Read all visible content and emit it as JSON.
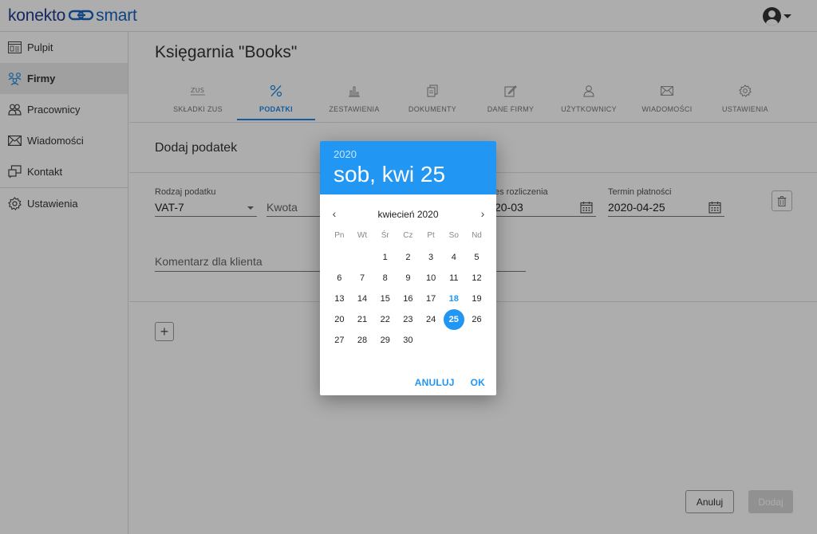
{
  "header": {
    "logo_part1": "konekto",
    "logo_part2": "smart",
    "account_icon": "account-circle-icon"
  },
  "sidebar": {
    "items": [
      {
        "label": "Pulpit",
        "icon": "dashboard-icon"
      },
      {
        "label": "Firmy",
        "icon": "companies-icon",
        "active": true
      },
      {
        "label": "Pracownicy",
        "icon": "employees-icon"
      },
      {
        "label": "Wiadomości",
        "icon": "mail-icon"
      },
      {
        "label": "Kontakt",
        "icon": "contact-icon"
      },
      {
        "label": "Ustawienia",
        "icon": "settings-icon"
      }
    ]
  },
  "main": {
    "page_title": "Księgarnia \"Books\"",
    "tabs": [
      {
        "label": "SKŁADKI ZUS",
        "icon": "zus-icon"
      },
      {
        "label": "PODATKI",
        "icon": "percent-icon",
        "active": true
      },
      {
        "label": "ZESTAWIENIA",
        "icon": "bar-chart-icon"
      },
      {
        "label": "DOKUMENTY",
        "icon": "documents-icon"
      },
      {
        "label": "DANE FIRMY",
        "icon": "edit-icon"
      },
      {
        "label": "UŻYTKOWNICY",
        "icon": "user-icon"
      },
      {
        "label": "WIADOMOŚCI",
        "icon": "mail-icon"
      },
      {
        "label": "USTAWIENIA",
        "icon": "gear-icon"
      }
    ],
    "section_title": "Dodaj podatek",
    "form": {
      "tax_type_label": "Rodzaj podatku",
      "tax_type_value": "VAT-7",
      "amount_placeholder": "Kwota",
      "period_label": "es rozliczenia",
      "period_value": "20-03",
      "due_label": "Termin płatności",
      "due_value": "2020-04-25",
      "comment_placeholder": "Komentarz dla klienta"
    },
    "cancel_label": "Anuluj",
    "add_label": "Dodaj"
  },
  "datepicker": {
    "year": "2020",
    "selected_display": "sob, kwi 25",
    "month_label": "kwiecień 2020",
    "weekdays": [
      "Pn",
      "Wt",
      "Śr",
      "Cz",
      "Pt",
      "So",
      "Nd"
    ],
    "weeks": [
      [
        "",
        "",
        "1",
        "2",
        "3",
        "4",
        "5"
      ],
      [
        "6",
        "7",
        "8",
        "9",
        "10",
        "11",
        "12"
      ],
      [
        "13",
        "14",
        "15",
        "16",
        "17",
        "18",
        "19"
      ],
      [
        "20",
        "21",
        "22",
        "23",
        "24",
        "25",
        "26"
      ],
      [
        "27",
        "28",
        "29",
        "30",
        "",
        "",
        ""
      ]
    ],
    "today": "18",
    "selected": "25",
    "cancel_label": "ANULUJ",
    "ok_label": "OK",
    "accent_color": "#2196f3"
  }
}
